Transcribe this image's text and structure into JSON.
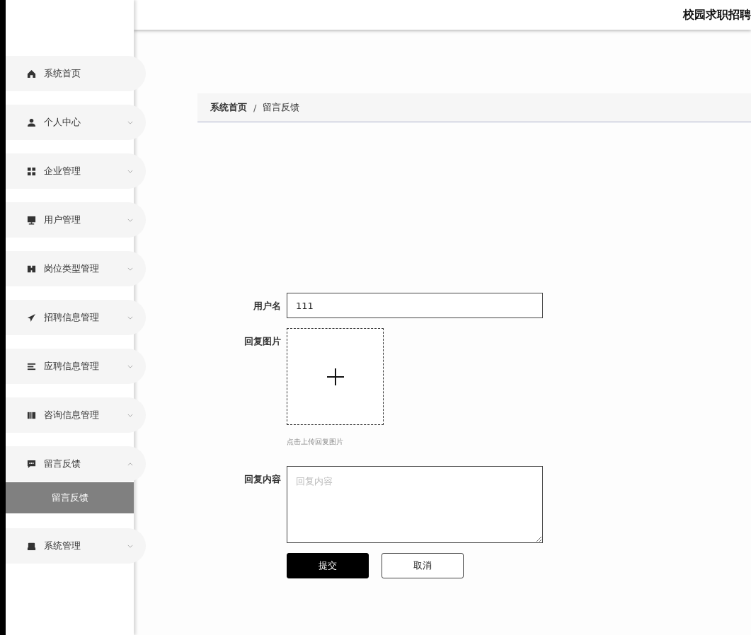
{
  "header": {
    "title": "校园求职招聘"
  },
  "sidebar": {
    "items": [
      {
        "label": "系统首页",
        "kind": "link"
      },
      {
        "label": "个人中心",
        "kind": "menu",
        "expanded": false
      },
      {
        "label": "企业管理",
        "kind": "menu",
        "expanded": false
      },
      {
        "label": "用户管理",
        "kind": "menu",
        "expanded": false
      },
      {
        "label": "岗位类型管理",
        "kind": "menu",
        "expanded": false
      },
      {
        "label": "招聘信息管理",
        "kind": "menu",
        "expanded": false
      },
      {
        "label": "应聘信息管理",
        "kind": "menu",
        "expanded": false
      },
      {
        "label": "咨询信息管理",
        "kind": "menu",
        "expanded": false
      },
      {
        "label": "留言反馈",
        "kind": "menu",
        "expanded": true,
        "children": [
          {
            "label": "留言反馈",
            "selected": true
          }
        ]
      },
      {
        "label": "系统管理",
        "kind": "menu",
        "expanded": false
      }
    ]
  },
  "breadcrumb": [
    "系统首页",
    "留言反馈"
  ],
  "breadcrumb_separator": "/",
  "form": {
    "fields": [
      {
        "label": "用户名",
        "kind": "text",
        "value": "111"
      },
      {
        "label": "回复图片",
        "kind": "upload",
        "hint": "点击上传回复图片"
      },
      {
        "label": "回复内容",
        "kind": "textarea",
        "placeholder": "回复内容"
      }
    ],
    "buttons": [
      {
        "label": "提交",
        "kind": "primary"
      },
      {
        "label": "取消",
        "kind": "secondary"
      }
    ]
  }
}
